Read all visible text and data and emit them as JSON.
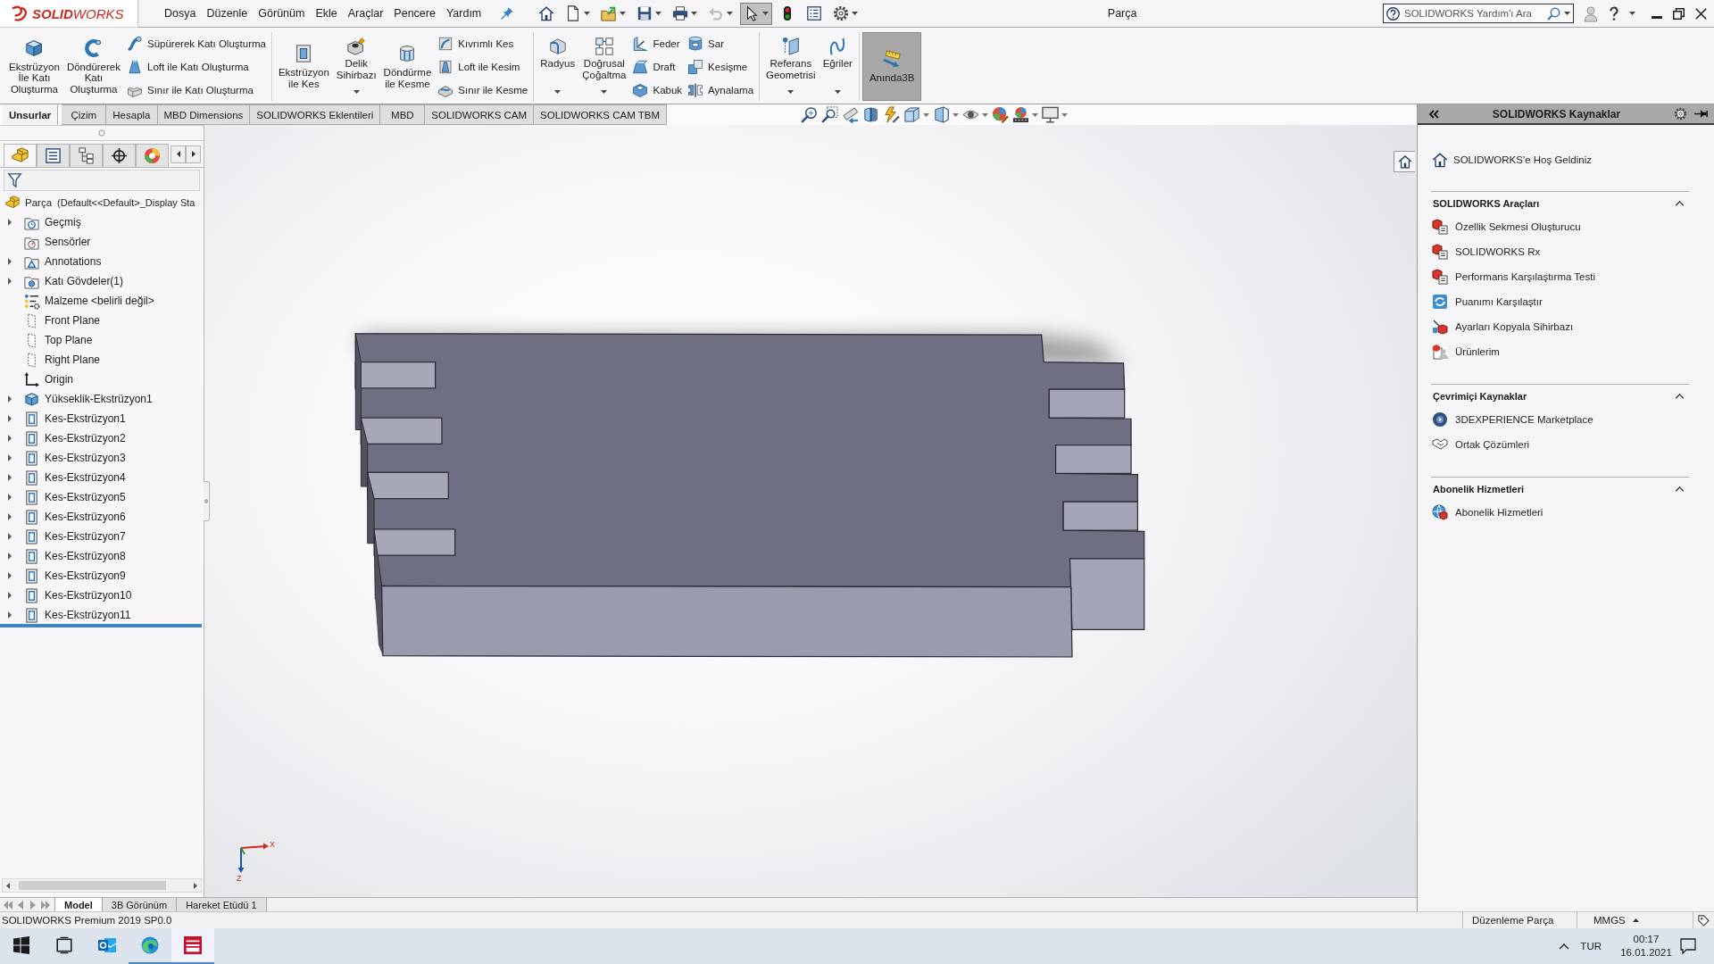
{
  "app": {
    "logo": "**SOLID**WORKS",
    "menu": [
      "Dosya",
      "Düzenle",
      "Görünüm",
      "Ekle",
      "Araçlar",
      "Pencere",
      "Yardım"
    ],
    "title": "Parça"
  },
  "quick_access": [
    {
      "dropdown": false,
      "selected": false,
      "disabled": false
    },
    {
      "dropdown": true,
      "selected": false,
      "disabled": false
    },
    {
      "dropdown": true,
      "selected": false,
      "disabled": false
    },
    {
      "dropdown": true,
      "selected": false,
      "disabled": false
    },
    {
      "dropdown": true,
      "selected": false,
      "disabled": false
    },
    {
      "dropdown": true,
      "selected": false,
      "disabled": true
    },
    {
      "dropdown": true,
      "selected": true,
      "disabled": false
    },
    {
      "dropdown": false,
      "selected": false,
      "disabled": false
    },
    {
      "dropdown": false,
      "selected": false,
      "disabled": false
    },
    {
      "dropdown": true,
      "selected": false,
      "disabled": false
    }
  ],
  "search": {
    "placeholder": "SOLIDWORKS Yardım'ı Ara"
  },
  "ribbon": {
    "groups": [
      {
        "items": [
          {
            "kind": "large",
            "label": "Ekstrüzyon\nİle Katı\nOluşturma",
            "dropdown": false,
            "on": false
          },
          {
            "kind": "large",
            "label": "Döndürerek\nKatı\nOluşturma",
            "dropdown": false,
            "on": false
          },
          {
            "kind": "stack",
            "buttons": [
              "Süpürerek Katı Oluşturma",
              "Loft ile Katı Oluşturma",
              "Sınır ile Katı Oluşturma"
            ]
          }
        ]
      },
      {
        "items": [
          {
            "kind": "large",
            "label": "Ekstrüzyon\nile Kes",
            "dropdown": false,
            "on": false
          },
          {
            "kind": "large",
            "label": "Delik\nSihirbazı",
            "dropdown": true,
            "on": false
          },
          {
            "kind": "large",
            "label": "Döndürme\nile Kesme",
            "dropdown": false,
            "on": false
          },
          {
            "kind": "stack",
            "buttons": [
              "Kıvrımlı Kes",
              "Loft ile Kesim",
              "Sınır ile Kesme"
            ]
          }
        ]
      },
      {
        "items": [
          {
            "kind": "large",
            "label": "Radyus",
            "dropdown": true,
            "on": false
          },
          {
            "kind": "large",
            "label": "Doğrusal\nÇoğaltma",
            "dropdown": true,
            "on": false
          },
          {
            "kind": "stack",
            "buttons": [
              "Feder",
              "Draft",
              "Kabuk"
            ]
          },
          {
            "kind": "stack",
            "buttons": [
              "Sar",
              "Kesişme",
              "Aynalama"
            ]
          }
        ]
      },
      {
        "items": [
          {
            "kind": "large",
            "label": "Referans\nGeometrisi",
            "dropdown": true,
            "on": false
          },
          {
            "kind": "large",
            "label": "Eğriler",
            "dropdown": true,
            "on": false
          }
        ]
      },
      {
        "items": [
          {
            "kind": "large",
            "label": "Anında3B",
            "dropdown": false,
            "on": true
          }
        ]
      }
    ]
  },
  "command_tabs": [
    {
      "label": "Unsurlar",
      "selected": true
    },
    {
      "label": "Çizim",
      "selected": false
    },
    {
      "label": "Hesapla",
      "selected": false
    },
    {
      "label": "MBD Dimensions",
      "selected": false
    },
    {
      "label": "SOLIDWORKS Eklentileri",
      "selected": false
    },
    {
      "label": "MBD",
      "selected": false
    },
    {
      "label": "SOLIDWORKS CAM",
      "selected": false
    },
    {
      "label": "SOLIDWORKS CAM TBM",
      "selected": false
    }
  ],
  "view_toolbar": [
    {
      "dropdown": false
    },
    {
      "dropdown": false
    },
    {
      "dropdown": false
    },
    {
      "dropdown": false
    },
    {
      "dropdown": false
    },
    {
      "dropdown": true
    },
    {
      "dropdown": true
    },
    {
      "dropdown": true
    },
    {
      "dropdown": false
    },
    {
      "dropdown": true
    },
    {
      "dropdown": true
    }
  ],
  "feature_manager": {
    "tabs": [
      {
        "selected": true
      },
      {
        "selected": false
      },
      {
        "selected": false
      },
      {
        "selected": false
      },
      {
        "selected": false
      }
    ],
    "root": {
      "label": "Parça",
      "config": "(Default<<Default>_Display Sta"
    },
    "items": [
      {
        "label": "Geçmiş",
        "kind": "history",
        "expandable": true
      },
      {
        "label": "Sensörler",
        "kind": "sensors",
        "expandable": false
      },
      {
        "label": "Annotations",
        "kind": "annotations",
        "expandable": true
      },
      {
        "label": "Katı Gövdeler(1)",
        "kind": "bodies",
        "expandable": true
      },
      {
        "label": "Malzeme <belirli değil>",
        "kind": "material",
        "expandable": false
      },
      {
        "label": "Front Plane",
        "kind": "plane",
        "expandable": false
      },
      {
        "label": "Top Plane",
        "kind": "plane",
        "expandable": false
      },
      {
        "label": "Right Plane",
        "kind": "plane",
        "expandable": false
      },
      {
        "label": "Origin",
        "kind": "origin",
        "expandable": false
      },
      {
        "label": "Yükseklik-Ekstrüzyon1",
        "kind": "boss",
        "expandable": true
      },
      {
        "label": "Kes-Ekstrüzyon1",
        "kind": "cut",
        "expandable": true
      },
      {
        "label": "Kes-Ekstrüzyon2",
        "kind": "cut",
        "expandable": true
      },
      {
        "label": "Kes-Ekstrüzyon3",
        "kind": "cut",
        "expandable": true
      },
      {
        "label": "Kes-Ekstrüzyon4",
        "kind": "cut",
        "expandable": true
      },
      {
        "label": "Kes-Ekstrüzyon5",
        "kind": "cut",
        "expandable": true
      },
      {
        "label": "Kes-Ekstrüzyon6",
        "kind": "cut",
        "expandable": true
      },
      {
        "label": "Kes-Ekstrüzyon7",
        "kind": "cut",
        "expandable": true
      },
      {
        "label": "Kes-Ekstrüzyon8",
        "kind": "cut",
        "expandable": true
      },
      {
        "label": "Kes-Ekstrüzyon9",
        "kind": "cut",
        "expandable": true
      },
      {
        "label": "Kes-Ekstrüzyon10",
        "kind": "cut",
        "expandable": true
      },
      {
        "label": "Kes-Ekstrüzyon11",
        "kind": "cut",
        "expandable": true
      }
    ]
  },
  "viewport": {
    "triad": [
      "X",
      "Z"
    ]
  },
  "task_pane": {
    "title": "SOLIDWORKS Kaynaklar",
    "welcome": "SOLIDWORKS'e Hoş Geldiniz",
    "sections": [
      {
        "title": "SOLIDWORKS Araçları",
        "expanded": true,
        "items": [
          "Özellik Sekmesi Oluşturucu",
          "SOLIDWORKS Rx",
          "Performans Karşılaştırma Testi",
          "Puanımı Karşılaştır",
          "Ayarları Kopyala Sihirbazı",
          "Ürünlerim"
        ]
      },
      {
        "title": "Çevrimiçi Kaynaklar",
        "expanded": true,
        "items": [
          "3DEXPERIENCE Marketplace",
          "Ortak Çözümleri"
        ]
      },
      {
        "title": "Abonelik Hizmetleri",
        "expanded": true,
        "items": [
          "Abonelik Hizmetleri"
        ]
      }
    ]
  },
  "model_tabs": [
    {
      "label": "Model",
      "selected": true
    },
    {
      "label": "3B Görünüm",
      "selected": false
    },
    {
      "label": "Hareket Etüdü 1",
      "selected": false
    }
  ],
  "status_bar": {
    "version": "SOLIDWORKS Premium 2019 SP0.0",
    "mode": "Düzenleme Parça",
    "units": "MMGS"
  },
  "taskbar": {
    "apps": [
      {
        "running": false,
        "selected": false
      },
      {
        "running": false,
        "selected": false
      },
      {
        "running": false,
        "selected": false
      },
      {
        "running": true,
        "selected": false
      },
      {
        "running": true,
        "selected": true
      }
    ],
    "language": "TUR",
    "time": "00:17",
    "date": "16.01.2021"
  }
}
